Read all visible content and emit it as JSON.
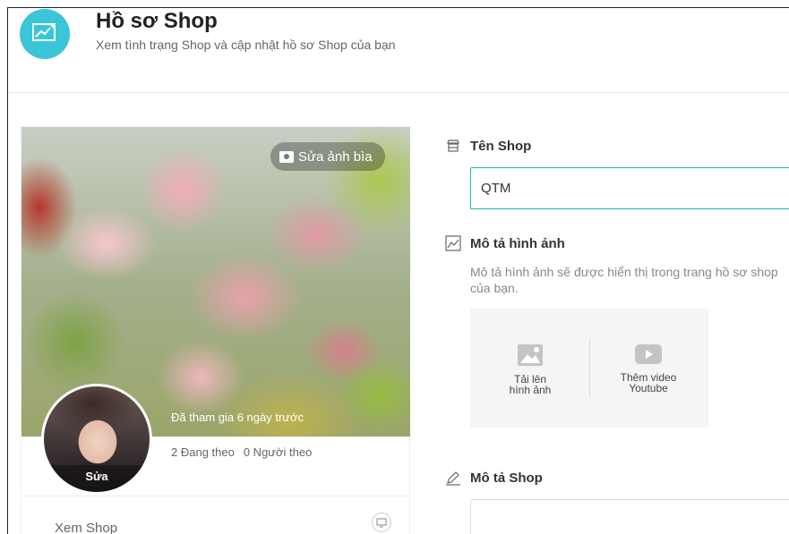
{
  "header": {
    "title": "Hồ sơ Shop",
    "subtitle": "Xem tình trạng Shop và cập nhật hồ sơ Shop của bạn",
    "icon": "chart-icon",
    "icon_bg": "#3ac6d8"
  },
  "profile_card": {
    "cover_button": "Sửa ảnh bìa",
    "joined_text": "Đã tham gia 6 ngày trước",
    "following_text": "2 Đang theo",
    "followers_text": "0 Người theo",
    "avatar_edit": "Sửa",
    "view_shop": "Xem Shop"
  },
  "form": {
    "shop_name_label": "Tên Shop",
    "shop_name_value": "QTM",
    "image_desc_label": "Mô tả hình ảnh",
    "image_desc_help": "Mô tả hình ảnh sẽ được hiển thị trong trang hồ sơ shop của bạn.",
    "upload_image": "Tải lên hình ảnh",
    "upload_image_line1": "Tải lên",
    "upload_image_line2": "hình ảnh",
    "add_video_line1": "Thêm video",
    "add_video_line2": "Youtube",
    "shop_desc_label": "Mô tả Shop",
    "accent_color": "#1fb3a9"
  }
}
